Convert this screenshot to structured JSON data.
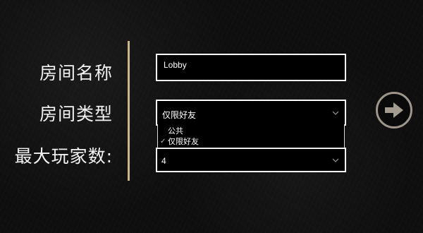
{
  "form": {
    "room_name_label": "房间名称",
    "room_type_label": "房间类型",
    "max_players_label": "最大玩家数:",
    "room_name_value": "Lobby",
    "room_type_value": "仅限好友",
    "max_players_value": "4"
  },
  "dropdown": {
    "options": [
      "公共",
      "仅限好友"
    ],
    "selected": "仅限好友"
  },
  "icons": {
    "next": "arrow-right-icon",
    "chevron": "chevron-down-icon",
    "check": "check-icon"
  },
  "colors": {
    "background": "#0e0e0e",
    "divider": "#c8b78a",
    "field_border": "#ffffff",
    "next_button_border": "#9e968a"
  }
}
